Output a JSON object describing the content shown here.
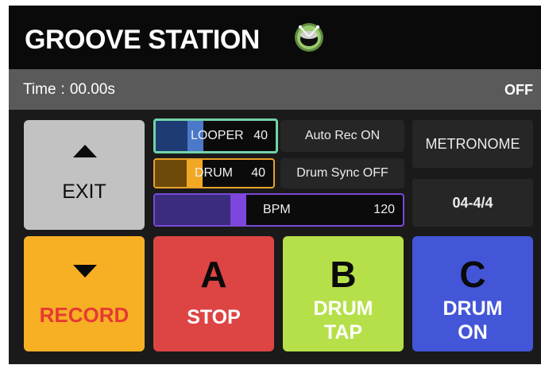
{
  "header": {
    "title": "GROOVE STATION",
    "logo_icon": "drum-icon"
  },
  "status": {
    "time_label": "Time",
    "time_separator": ":",
    "time_value": "00.00s",
    "state": "OFF"
  },
  "controls": {
    "exit_label": "EXIT",
    "record_label": "RECORD",
    "looper": {
      "label": "LOOPER",
      "value": "40",
      "level": 0.4
    },
    "drum": {
      "label": "DRUM",
      "value": "40",
      "level": 0.4
    },
    "bpm": {
      "label": "BPM",
      "value": "120",
      "level": 0.37
    },
    "auto_rec": "Auto Rec ON",
    "drum_sync": "Drum Sync OFF",
    "metronome": "METRONOME",
    "time_signature": "04-4/4"
  },
  "pads": {
    "a": {
      "letter": "A",
      "label": "STOP"
    },
    "b": {
      "letter": "B",
      "label_line1": "DRUM",
      "label_line2": "TAP"
    },
    "c": {
      "letter": "C",
      "label_line1": "DRUM",
      "label_line2": "ON"
    }
  },
  "colors": {
    "exit": "#c2c2c2",
    "record": "#f7af24",
    "record_text": "#e63a33",
    "pad_a": "#dd4444",
    "pad_b": "#b5e04a",
    "pad_c": "#4456d8",
    "looper_accent": "#73d2a8",
    "drum_accent": "#e7a22a",
    "bpm_accent": "#7a49d8"
  }
}
